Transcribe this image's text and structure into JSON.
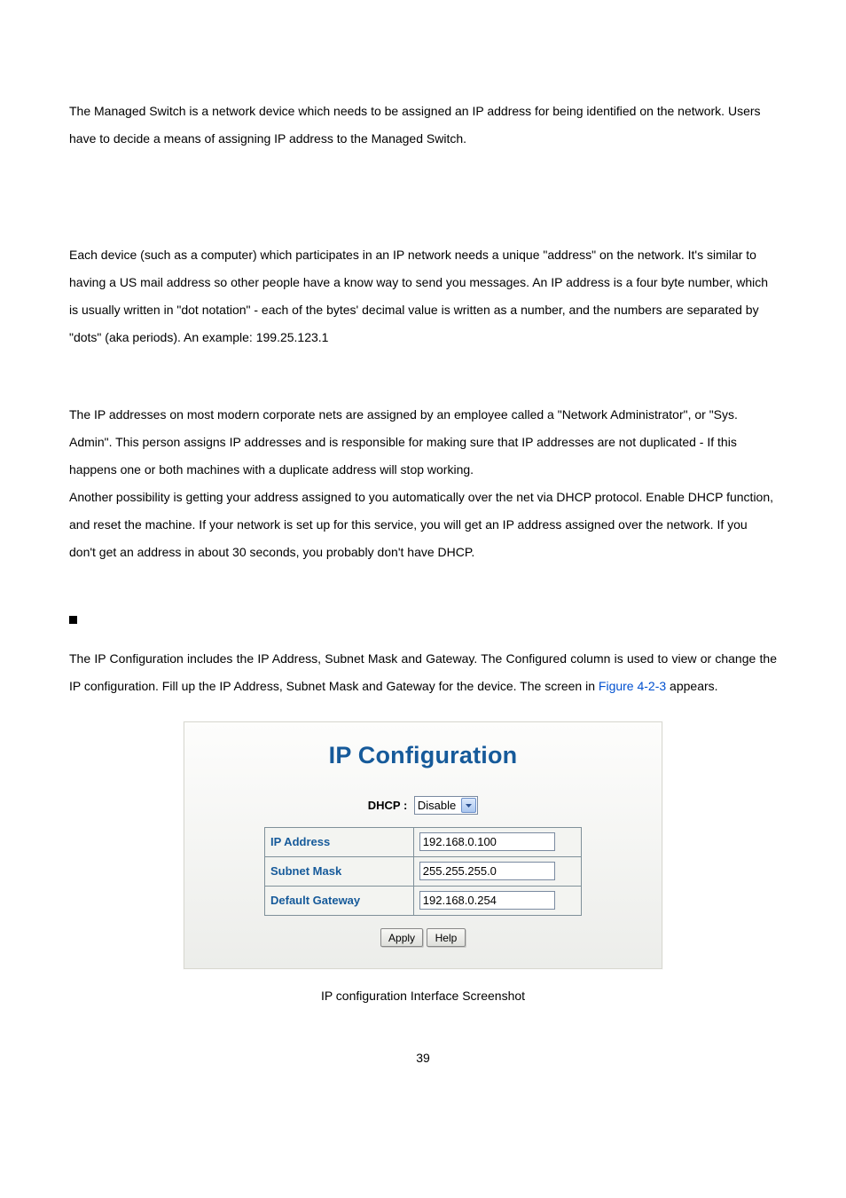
{
  "para1": "The Managed Switch is a network device which needs to be assigned an IP address for being identified on the network. Users have to decide a means of assigning IP address to the Managed Switch.",
  "para2": "Each device (such as a computer) which participates in an IP network needs a unique \"address\" on the network. It's similar to having a US mail address so other people have a know way to send you messages. An IP address is a four byte number, which is usually written in \"dot notation\" - each of the bytes' decimal value is written as a number, and the numbers are separated by \"dots\" (aka periods). An example: 199.25.123.1",
  "para3": "The IP addresses on most modern corporate nets are assigned by an employee called a \"Network Administrator\", or \"Sys. Admin\". This person assigns IP addresses and is responsible for making sure that IP addresses are not duplicated - If this happens one or both machines with a duplicate address will stop working.",
  "para4": "Another possibility is getting your address assigned to you automatically over the net via DHCP protocol. Enable DHCP function, and reset the machine. If your network is set up for this service, you will get an IP address assigned over the network. If you don't get an address in about 30 seconds, you probably don't have DHCP.",
  "para5_a": "The IP Configuration includes the IP Address, Subnet Mask and Gateway. The Configured column is used to view or change the IP configuration. Fill up the IP Address, Subnet Mask and Gateway for the device. The screen in ",
  "para5_link": "Figure 4-2-3",
  "para5_b": " appears.",
  "panel": {
    "title": "IP Configuration",
    "dhcp_label": "DHCP :",
    "dhcp_value": "Disable",
    "rows": {
      "ip_label": "IP Address",
      "ip_value": "192.168.0.100",
      "mask_label": "Subnet Mask",
      "mask_value": "255.255.255.0",
      "gw_label": "Default Gateway",
      "gw_value": "192.168.0.254"
    },
    "apply": "Apply",
    "help": "Help"
  },
  "caption": "IP configuration Interface Screenshot",
  "pagenum": "39"
}
